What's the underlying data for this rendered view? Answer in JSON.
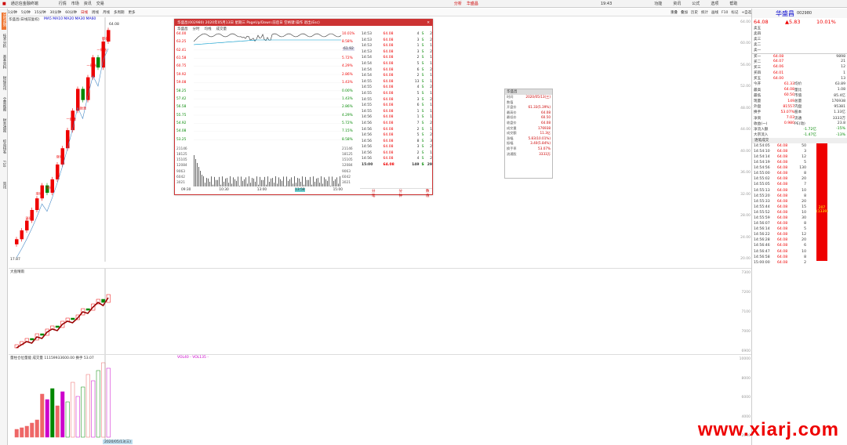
{
  "titlebar": {
    "app": "通达信金融终端",
    "menus": [
      "行情",
      "市场",
      "资讯",
      "交易"
    ],
    "center": [
      "分析",
      "华盛昌"
    ],
    "right": [
      "功能",
      "资讯",
      "公式",
      "选项",
      "帮助"
    ],
    "time": "19:43"
  },
  "toolbar": {
    "items": [
      "1分钟",
      "5分钟",
      "15分钟",
      "30分钟",
      "60分钟",
      "日线",
      "周线",
      "月线",
      "多周期",
      "更多"
    ],
    "right": [
      "重叠",
      "叠加",
      "历史",
      "统计",
      "画线",
      "F10",
      "标记",
      "+自选",
      "返回"
    ]
  },
  "left_tabs": [
    "分时走势",
    "技术分析",
    "基本资料",
    "财经资讯",
    "全景视图",
    "财务透视",
    "综合排名",
    "F10",
    "资讯"
  ],
  "main_chart": {
    "stock_label": "华盛昌(日线前复权)",
    "ma_text": "MA5 MA10 MA20 MA30 MA60",
    "top_price": "64.08",
    "low_label": "17.87",
    "annotations": [
      "涨停",
      "涨停",
      "涨停",
      "涨停",
      "一致涨",
      "一致涨",
      "一致涨",
      "一致涨",
      "断板"
    ],
    "y_ticks": [
      "64.00",
      "60.00",
      "56.00",
      "52.00",
      "48.00",
      "44.00",
      "40.00",
      "36.00",
      "32.00",
      "28.00",
      "24.00",
      "20.00"
    ],
    "kbars": [
      {
        "o": 17.9,
        "c": 19.0
      },
      {
        "o": 19.0,
        "c": 20.9
      },
      {
        "o": 20.9,
        "c": 23.0
      },
      {
        "o": 23.0,
        "c": 25.3
      },
      {
        "o": 25.3,
        "c": 27.8
      },
      {
        "o": 27.8,
        "c": 30.6
      },
      {
        "o": 30.6,
        "c": 29.0
      },
      {
        "o": 29.0,
        "c": 31.9
      },
      {
        "o": 31.9,
        "c": 35.1
      },
      {
        "o": 35.1,
        "c": 38.6
      },
      {
        "o": 38.6,
        "c": 42.5
      },
      {
        "o": 42.5,
        "c": 46.7
      },
      {
        "o": 46.7,
        "c": 51.4
      },
      {
        "o": 51.4,
        "c": 49.0
      },
      {
        "o": 49.0,
        "c": 53.9
      },
      {
        "o": 53.9,
        "c": 58.2
      },
      {
        "o": 58.2,
        "c": 56.0
      },
      {
        "o": 56.0,
        "c": 61.6
      },
      {
        "o": 61.6,
        "c": 64.08
      }
    ]
  },
  "mid_chart": {
    "label": "大盘晴雨",
    "y_ticks": [
      "7300",
      "7200",
      "7100",
      "7000",
      "6900"
    ]
  },
  "vol_chart": {
    "label": "量柱仓位量能 成交量 11159933600.00 换手 53.07",
    "legend": "VOL40 - VOL135 -",
    "y_ticks": [
      "10000",
      "8000",
      "6000",
      "4000",
      "2000"
    ],
    "date_label": "2020/05/13(三)",
    "bars": [
      10,
      12,
      14,
      18,
      22,
      55,
      48,
      62,
      40,
      58,
      45,
      70,
      52,
      64,
      80,
      72,
      85,
      95,
      88
    ]
  },
  "window": {
    "title": "华盛昌(002980) 2020年05月13日 星期三 PageUp/Down:前后日 空格键:操作 退出(Esc)",
    "tabs": [
      "华盛昌",
      "分时",
      "均线",
      "成交量"
    ],
    "left_prices": [
      "64.00",
      "63.25",
      "62.41",
      "61.58",
      "60.75",
      "59.92",
      "59.08",
      "58.25",
      "57.42",
      "56.58",
      "55.75",
      "54.92",
      "54.08",
      "53.25"
    ],
    "pcts": [
      "10.01%",
      "8.58%",
      "7.15%",
      "5.72%",
      "4.29%",
      "2.86%",
      "1.43%",
      "0.00%",
      "1.43%",
      "2.86%",
      "4.29%",
      "5.72%",
      "7.15%",
      "8.58%"
    ],
    "vol_axis": [
      "21146",
      "18125",
      "15105",
      "12084",
      "9063",
      "6042",
      "3021"
    ],
    "times": [
      "09:30",
      "10:30",
      "13:00",
      "13:58",
      "15:00"
    ],
    "mark_price": "61.92",
    "ticks": [
      [
        "14:53",
        "64.08",
        "4",
        "S",
        "2"
      ],
      [
        "14:53",
        "64.08",
        "3",
        "S",
        "2"
      ],
      [
        "14:53",
        "64.08",
        "1",
        "S",
        "1"
      ],
      [
        "14:53",
        "64.08",
        "3",
        "S",
        "2"
      ],
      [
        "14:54",
        "64.08",
        "2",
        "S",
        "1"
      ],
      [
        "14:54",
        "64.08",
        "5",
        "S",
        "1"
      ],
      [
        "14:54",
        "64.08",
        "6",
        "S",
        "2"
      ],
      [
        "14:54",
        "64.08",
        "2",
        "S",
        "1"
      ],
      [
        "14:55",
        "64.08",
        "13",
        "S",
        "1"
      ],
      [
        "14:55",
        "64.08",
        "4",
        "S",
        "2"
      ],
      [
        "14:55",
        "64.08",
        "5",
        "S",
        "1"
      ],
      [
        "14:55",
        "64.08",
        "3",
        "S",
        "2"
      ],
      [
        "14:55",
        "64.08",
        "6",
        "S",
        "1"
      ],
      [
        "14:55",
        "64.08",
        "1",
        "S",
        "1"
      ],
      [
        "14:56",
        "64.08",
        "1",
        "S",
        "1"
      ],
      [
        "14:56",
        "64.08",
        "7",
        "S",
        "2"
      ],
      [
        "14:56",
        "64.08",
        "2",
        "S",
        "1"
      ],
      [
        "14:56",
        "64.08",
        "5",
        "S",
        "2"
      ],
      [
        "14:56",
        "64.08",
        "8",
        "S",
        "3"
      ],
      [
        "14:56",
        "64.08",
        "3",
        "S",
        "2"
      ],
      [
        "14:56",
        "64.08",
        "2",
        "S",
        "1"
      ],
      [
        "14:56",
        "64.08",
        "4",
        "S",
        "2"
      ],
      [
        "15:00",
        "64.08",
        "149",
        "S",
        "29"
      ]
    ],
    "foot": [
      "分笔",
      "分钟",
      "数值"
    ]
  },
  "info": {
    "title": "华盛昌",
    "rows": [
      [
        "时间",
        "2020/05/13(三)"
      ],
      [
        "数值",
        ""
      ],
      [
        "开盘价",
        "61.33(5.39%)"
      ],
      [
        "最高价",
        "64.08"
      ],
      [
        "最低价",
        "60.50"
      ],
      [
        "收盘价",
        "64.08"
      ],
      [
        "成交量",
        "176938"
      ],
      [
        "成交额",
        "11.3亿"
      ],
      [
        "涨幅",
        "5.83(10.01%)"
      ],
      [
        "振幅",
        "3.40(5.84%)"
      ],
      [
        "换手率",
        "53.07%"
      ],
      [
        "流通股",
        "3333万"
      ]
    ]
  },
  "quote": {
    "name": "华盛昌",
    "code": "002980",
    "price": "64.08",
    "chg": "▲5.83",
    "pct": "10.01%",
    "sell": [
      [
        "卖五",
        ""
      ],
      [
        "卖四",
        ""
      ],
      [
        "卖三",
        ""
      ],
      [
        "卖二",
        ""
      ],
      [
        "卖一",
        ""
      ]
    ],
    "buy": [
      [
        "买一",
        "64.08",
        "9898"
      ],
      [
        "买二",
        "64.07",
        "21"
      ],
      [
        "买三",
        "64.06",
        "12"
      ],
      [
        "买四",
        "64.01",
        "1"
      ],
      [
        "买五",
        "64.00",
        "13"
      ]
    ],
    "stats": [
      [
        "今开",
        "61.33",
        "均价",
        "63.89"
      ],
      [
        "最高",
        "64.08",
        "量比",
        "1.08"
      ],
      [
        "最低",
        "60.50",
        "市值",
        "85.4亿"
      ],
      [
        "现量",
        "149",
        "总量",
        "176938"
      ],
      [
        "外盘",
        "81557",
        "内盘",
        "95381"
      ],
      [
        "换手",
        "53.07%",
        "股本",
        "1.33亿"
      ],
      [
        "净资",
        "7.03",
        "流通",
        "3333万"
      ],
      [
        "收益(一)",
        "0.980",
        "PE(动)",
        "23.8"
      ]
    ],
    "flow": [
      [
        "净流入额",
        "-1.72亿",
        "-15%"
      ],
      [
        "大宗流入",
        "-1.47亿",
        "-13%"
      ]
    ],
    "detail_tab": "逐笔成交",
    "detail": [
      [
        "14:54:05",
        "64.08",
        "50"
      ],
      [
        "14:54:10",
        "64.08",
        "3"
      ],
      [
        "14:54:14",
        "64.08",
        "12"
      ],
      [
        "14:54:19",
        "64.08",
        "5"
      ],
      [
        "14:54:56",
        "64.08",
        "130"
      ],
      [
        "14:55:00",
        "64.08",
        "8"
      ],
      [
        "14:55:02",
        "64.08",
        "20"
      ],
      [
        "14:55:05",
        "64.08",
        "7"
      ],
      [
        "14:55:13",
        "64.08",
        "10"
      ],
      [
        "14:55:20",
        "64.08",
        "8"
      ],
      [
        "14:55:33",
        "64.08",
        "20"
      ],
      [
        "14:55:44",
        "64.08",
        "15"
      ],
      [
        "14:55:52",
        "64.08",
        "10"
      ],
      [
        "14:55:59",
        "64.08",
        "30"
      ],
      [
        "14:56:07",
        "64.08",
        "8"
      ],
      [
        "14:56:14",
        "64.08",
        "5"
      ],
      [
        "14:56:22",
        "64.08",
        "12"
      ],
      [
        "14:56:28",
        "64.08",
        "20"
      ],
      [
        "14:56:46",
        "64.08",
        "6"
      ],
      [
        "14:56:47",
        "64.08",
        "10"
      ],
      [
        "14:56:58",
        "64.08",
        "8"
      ],
      [
        "15:00:00",
        "64.08",
        "2"
      ]
    ],
    "big_bar": "207",
    "big_bar2": "(1339)"
  },
  "watermark": "www.xiarj.com"
}
